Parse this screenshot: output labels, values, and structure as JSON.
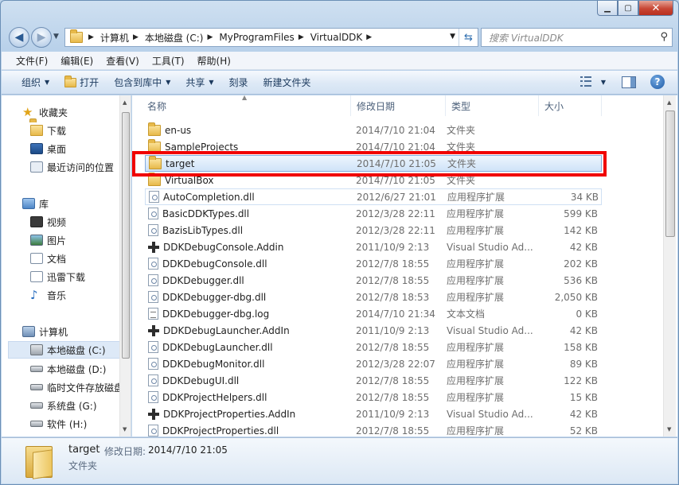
{
  "window": {
    "caption_buttons": {
      "minimize": "▁",
      "maximize": "▢",
      "close": "✕"
    }
  },
  "address": {
    "crumbs": [
      "计算机",
      "本地磁盘 (C:)",
      "MyProgramFiles",
      "VirtualDDK"
    ],
    "search_placeholder": "搜索 VirtualDDK"
  },
  "menubar": [
    "文件(F)",
    "编辑(E)",
    "查看(V)",
    "工具(T)",
    "帮助(H)"
  ],
  "commands": {
    "organize": "组织",
    "open": "打开",
    "include_library": "包含到库中",
    "share": "共享",
    "burn": "刻录",
    "new_folder": "新建文件夹"
  },
  "navpane": {
    "favorites": "收藏夹",
    "fav_items": [
      "下载",
      "桌面",
      "最近访问的位置"
    ],
    "libraries": "库",
    "lib_items": [
      "视频",
      "图片",
      "文档",
      "迅雷下载",
      "音乐"
    ],
    "computer": "计算机",
    "drives": [
      "本地磁盘 (C:)",
      "本地磁盘 (D:)",
      "临时文件存放磁盘",
      "系统盘 (G:)",
      "软件 (H:)"
    ]
  },
  "columns": {
    "name": "名称",
    "modified": "修改日期",
    "type": "类型",
    "size": "大小"
  },
  "files": [
    {
      "name": "en-us",
      "date": "2014/7/10 21:04",
      "type": "文件夹",
      "size": "",
      "icon": "folder"
    },
    {
      "name": "SampleProjects",
      "date": "2014/7/10 21:04",
      "type": "文件夹",
      "size": "",
      "icon": "folder"
    },
    {
      "name": "target",
      "date": "2014/7/10 21:05",
      "type": "文件夹",
      "size": "",
      "icon": "folder"
    },
    {
      "name": "VirtualBox",
      "date": "2014/7/10 21:05",
      "type": "文件夹",
      "size": "",
      "icon": "folder"
    },
    {
      "name": "AutoCompletion.dll",
      "date": "2012/6/27 21:01",
      "type": "应用程序扩展",
      "size": "34 KB",
      "icon": "dll"
    },
    {
      "name": "BasicDDKTypes.dll",
      "date": "2012/3/28 22:11",
      "type": "应用程序扩展",
      "size": "599 KB",
      "icon": "dll"
    },
    {
      "name": "BazisLibTypes.dll",
      "date": "2012/3/28 22:11",
      "type": "应用程序扩展",
      "size": "142 KB",
      "icon": "dll"
    },
    {
      "name": "DDKDebugConsole.Addin",
      "date": "2011/10/9 2:13",
      "type": "Visual Studio Ad...",
      "size": "42 KB",
      "icon": "addin"
    },
    {
      "name": "DDKDebugConsole.dll",
      "date": "2012/7/8 18:55",
      "type": "应用程序扩展",
      "size": "202 KB",
      "icon": "dll"
    },
    {
      "name": "DDKDebugger.dll",
      "date": "2012/7/8 18:55",
      "type": "应用程序扩展",
      "size": "536 KB",
      "icon": "dll"
    },
    {
      "name": "DDKDebugger-dbg.dll",
      "date": "2012/7/8 18:53",
      "type": "应用程序扩展",
      "size": "2,050 KB",
      "icon": "dll"
    },
    {
      "name": "DDKDebugger-dbg.log",
      "date": "2014/7/10 21:34",
      "type": "文本文档",
      "size": "0 KB",
      "icon": "log"
    },
    {
      "name": "DDKDebugLauncher.AddIn",
      "date": "2011/10/9 2:13",
      "type": "Visual Studio Ad...",
      "size": "42 KB",
      "icon": "addin"
    },
    {
      "name": "DDKDebugLauncher.dll",
      "date": "2012/7/8 18:55",
      "type": "应用程序扩展",
      "size": "158 KB",
      "icon": "dll"
    },
    {
      "name": "DDKDebugMonitor.dll",
      "date": "2012/3/28 22:07",
      "type": "应用程序扩展",
      "size": "89 KB",
      "icon": "dll"
    },
    {
      "name": "DDKDebugUI.dll",
      "date": "2012/7/8 18:55",
      "type": "应用程序扩展",
      "size": "122 KB",
      "icon": "dll"
    },
    {
      "name": "DDKProjectHelpers.dll",
      "date": "2012/7/8 18:55",
      "type": "应用程序扩展",
      "size": "15 KB",
      "icon": "dll"
    },
    {
      "name": "DDKProjectProperties.AddIn",
      "date": "2011/10/9 2:13",
      "type": "Visual Studio Ad...",
      "size": "42 KB",
      "icon": "addin"
    },
    {
      "name": "DDKProjectProperties.dll",
      "date": "2012/7/8 18:55",
      "type": "应用程序扩展",
      "size": "52 KB",
      "icon": "dll"
    }
  ],
  "details": {
    "name": "target",
    "modified_label": "修改日期:",
    "modified_value": "2014/7/10 21:05",
    "type": "文件夹"
  }
}
